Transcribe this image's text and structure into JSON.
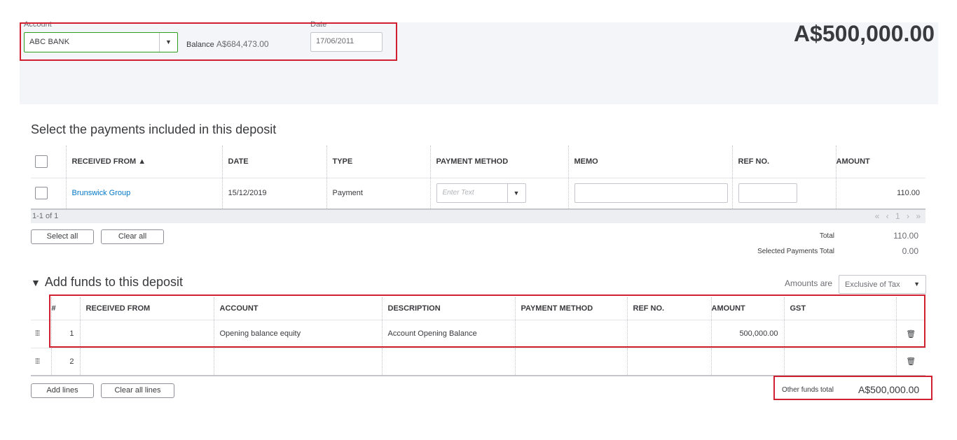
{
  "header": {
    "account_label": "Account",
    "account_value": "ABC BANK",
    "balance_label": "Balance",
    "balance_value": "A$684,473.00",
    "date_label": "Date",
    "date_value": "17/06/2011",
    "amount_total": "A$500,000.00"
  },
  "payments": {
    "title": "Select the payments included in this deposit",
    "columns": {
      "received_from": "RECEIVED FROM ▲",
      "date": "DATE",
      "type": "TYPE",
      "payment_method": "PAYMENT METHOD",
      "memo": "MEMO",
      "ref_no": "REF NO.",
      "amount": "AMOUNT"
    },
    "rows": [
      {
        "received_from": "Brunswick Group",
        "date": "15/12/2019",
        "type": "Payment",
        "payment_method_placeholder": "Enter Text",
        "amount": "110.00"
      }
    ],
    "pager_count": "1-1 of 1",
    "pager_nav": "« ‹ 1 › »",
    "select_all_label": "Select all",
    "clear_all_label": "Clear all",
    "total_label": "Total",
    "total_value": "110.00",
    "selected_total_label": "Selected Payments Total",
    "selected_total_value": "0.00"
  },
  "funds": {
    "toggle_icon": "▼",
    "title": "Add funds to this deposit",
    "amounts_are_label": "Amounts are",
    "tax_mode": "Exclusive of Tax",
    "columns": {
      "num": "#",
      "received_from": "RECEIVED FROM",
      "account": "ACCOUNT",
      "description": "DESCRIPTION",
      "payment_method": "PAYMENT METHOD",
      "ref_no": "REF NO.",
      "amount": "AMOUNT",
      "gst": "GST"
    },
    "rows": [
      {
        "num": "1",
        "account": "Opening balance equity",
        "description": "Account Opening Balance",
        "amount": "500,000.00"
      },
      {
        "num": "2",
        "account": "",
        "description": "",
        "amount": ""
      }
    ],
    "add_lines_label": "Add lines",
    "clear_all_lines_label": "Clear all lines",
    "other_total_label": "Other funds total",
    "other_total_value": "A$500,000.00"
  },
  "colors": {
    "highlight": "#d0202f",
    "link": "#0077c5",
    "focus_border": "#2ca01c"
  },
  "icons": {
    "dropdown": "chevron-down-icon",
    "drag": "drag-handle-icon",
    "delete": "trash-icon"
  }
}
